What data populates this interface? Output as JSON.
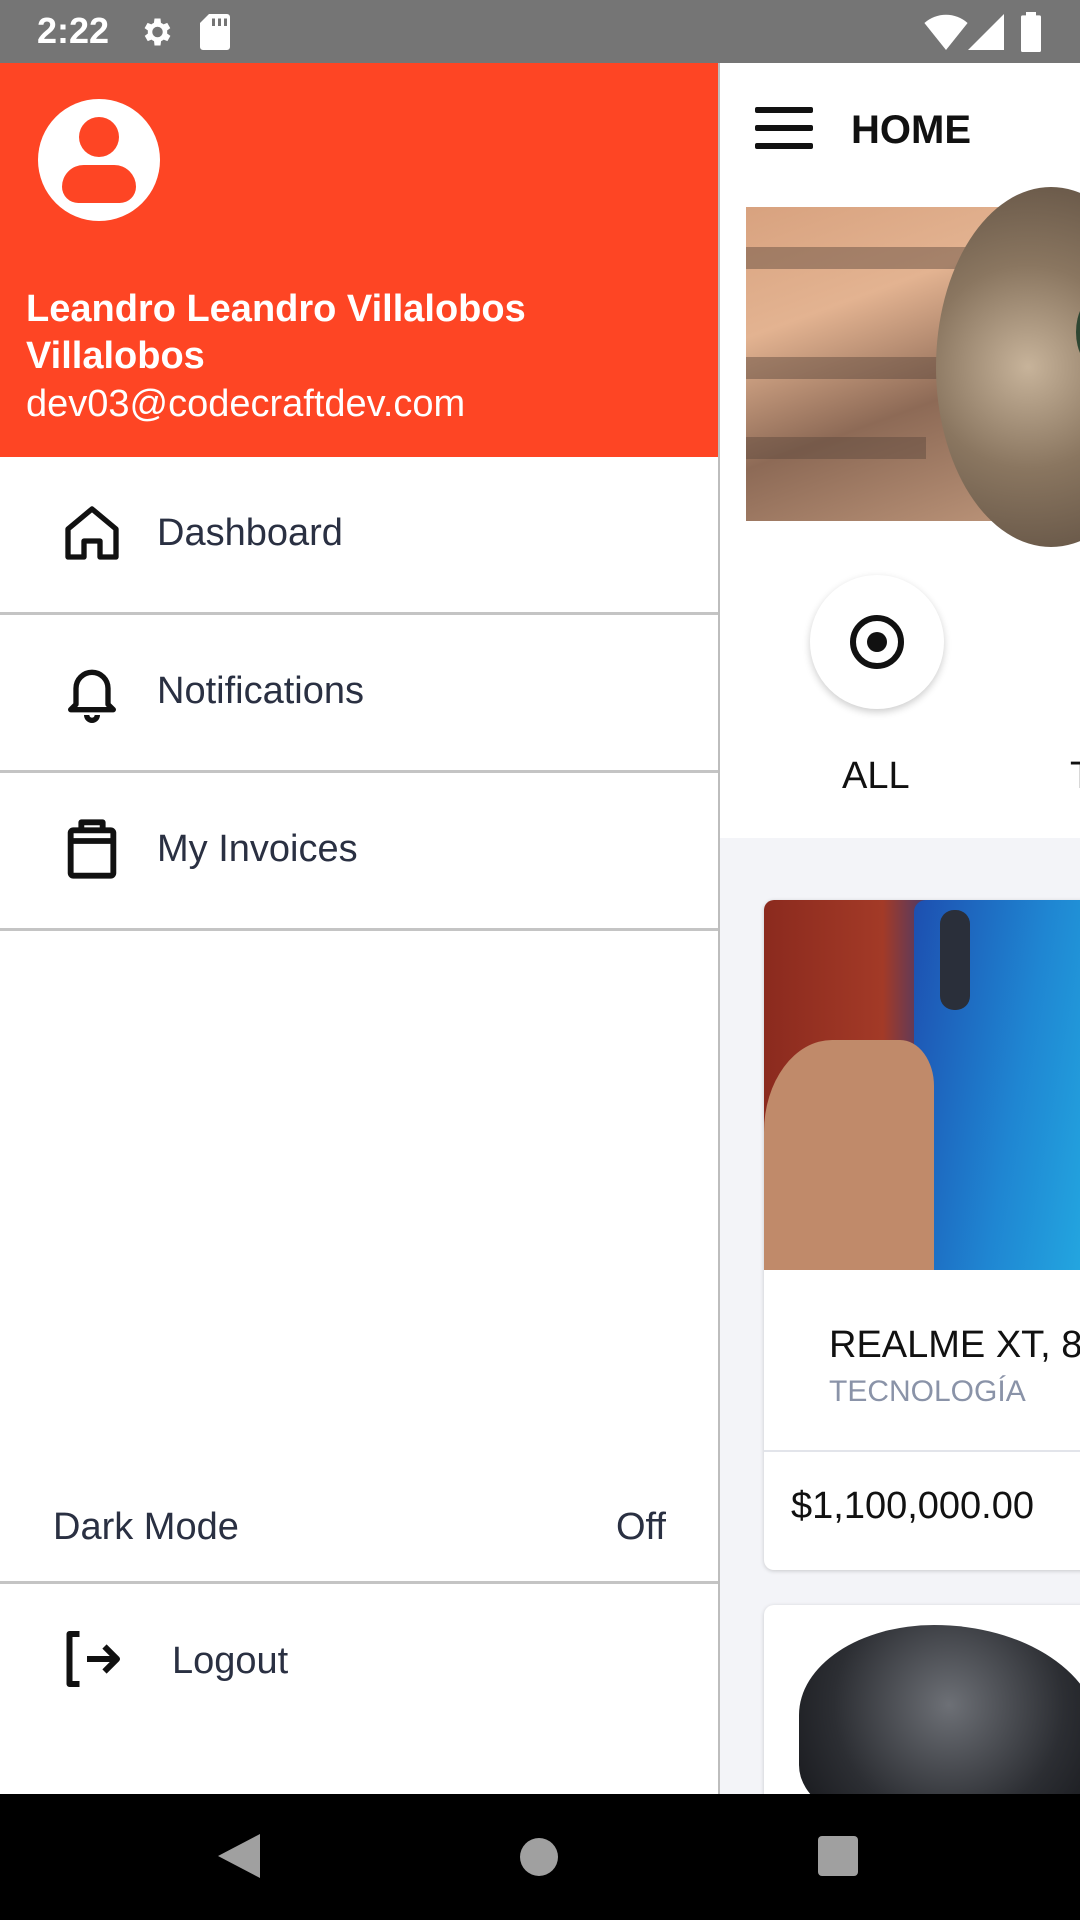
{
  "status_bar": {
    "time": "2:22",
    "icons": [
      "gear-icon",
      "sd-card-icon",
      "wifi-icon",
      "signal-icon",
      "battery-icon"
    ]
  },
  "drawer": {
    "header_color": "#fe4524",
    "user_name": "Leandro Leandro Villalobos Villalobos",
    "user_email": "dev03@codecraftdev.com",
    "items": [
      {
        "label": "Dashboard",
        "icon": "home-icon"
      },
      {
        "label": "Notifications",
        "icon": "bell-icon"
      },
      {
        "label": "My Invoices",
        "icon": "clipboard-icon"
      }
    ],
    "dark_mode": {
      "label": "Dark Mode",
      "value": "Off"
    },
    "logout": {
      "label": "Logout",
      "icon": "logout-icon"
    }
  },
  "main": {
    "title": "HOME",
    "categories": [
      {
        "label": "ALL",
        "icon": "target-icon"
      },
      {
        "label": "T"
      }
    ],
    "products": [
      {
        "title": "REALME XT, 8",
        "category": "TECNOLOGÍA",
        "price": "$1,100,000.00"
      }
    ]
  }
}
